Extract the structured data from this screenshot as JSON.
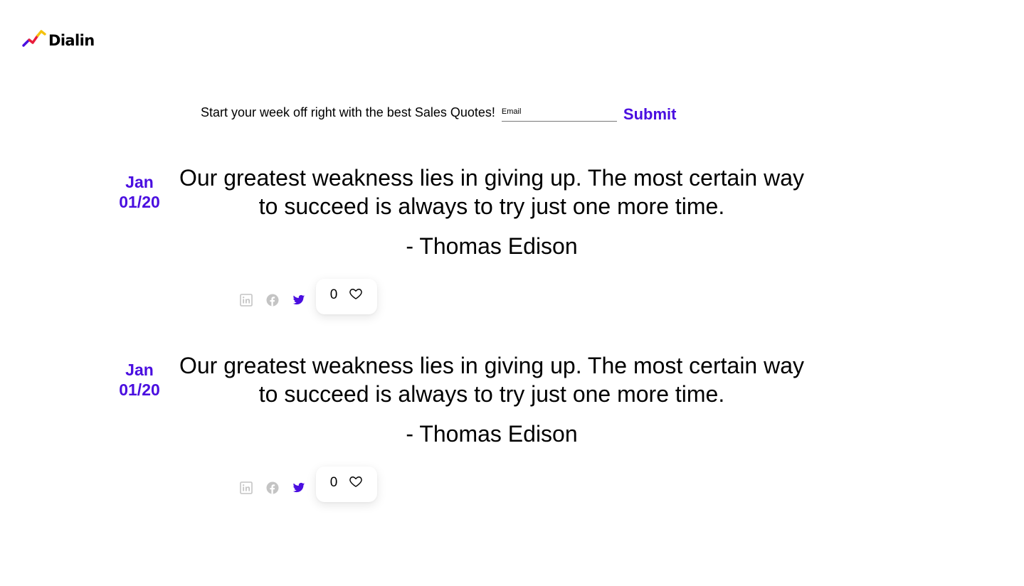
{
  "brand": {
    "name": "Dialin",
    "logo_icon": "chart-checkmark-icon",
    "colors": {
      "accent": "#4a0ee0",
      "logo_red": "#e81c3b",
      "logo_yellow": "#f4c20d"
    }
  },
  "newsletter": {
    "text": "Start your week off right with the best Sales Quotes!",
    "email_placeholder": "Email",
    "email_value": "",
    "submit_label": "Submit"
  },
  "quotes": [
    {
      "date_month": "Jan",
      "date_day": "01/20",
      "text": "Our greatest weakness lies in giving up. The most certain way to succeed is always to try just one more time.",
      "author": "- Thomas Edison",
      "like_count": "0",
      "share_icons": [
        "linkedin-icon",
        "facebook-icon",
        "twitter-icon"
      ],
      "like_icon": "heart-outline-icon"
    },
    {
      "date_month": "Jan",
      "date_day": "01/20",
      "text": "Our greatest weakness lies in giving up. The most certain way to succeed is always to try just one more time.",
      "author": "- Thomas Edison",
      "like_count": "0",
      "share_icons": [
        "linkedin-icon",
        "facebook-icon",
        "twitter-icon"
      ],
      "like_icon": "heart-outline-icon"
    }
  ],
  "colors": {
    "icon_inactive": "#c4c4c4",
    "twitter_active": "#4a0ee0"
  }
}
